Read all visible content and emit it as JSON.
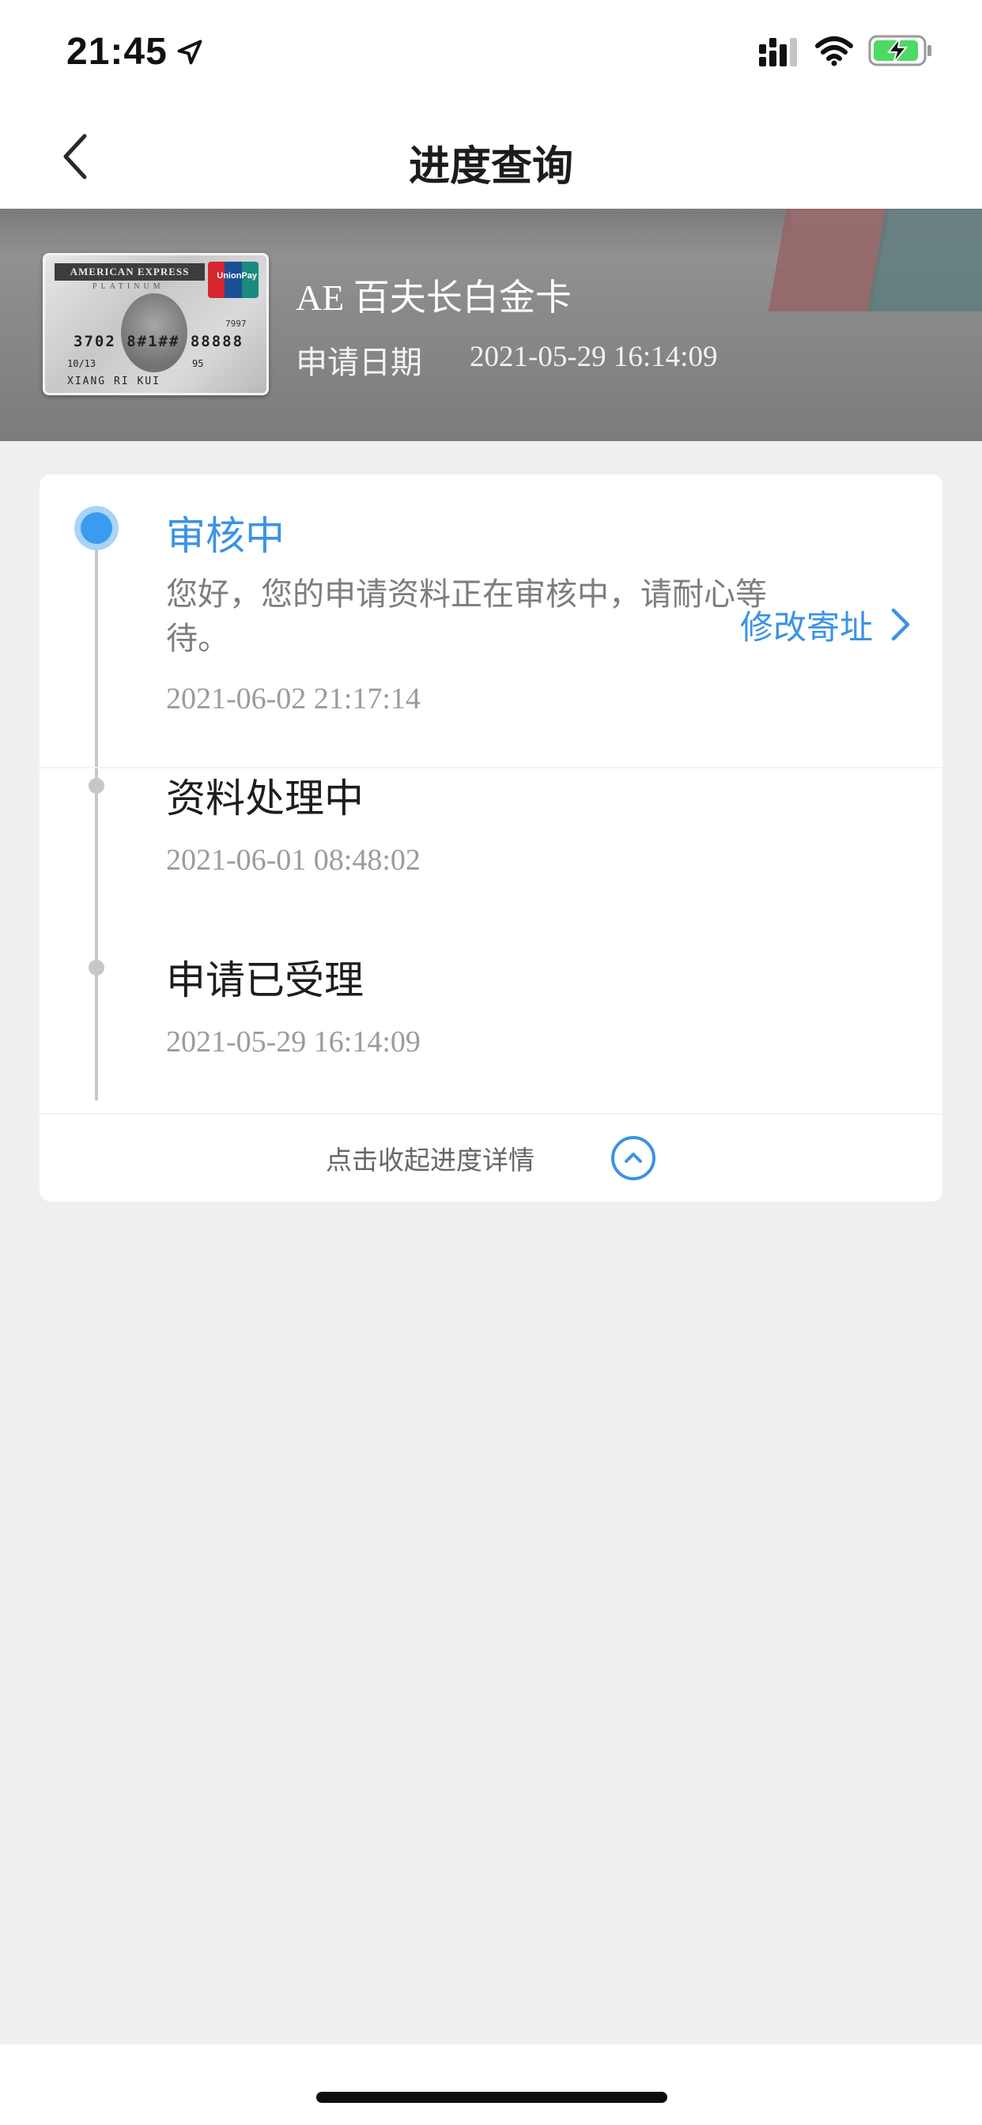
{
  "status_bar": {
    "time": "21:45"
  },
  "nav": {
    "title": "进度查询"
  },
  "card": {
    "brand": "AMERICAN EXPRESS",
    "tier": "PLATINUM",
    "union_pay": "UnionPay",
    "number": "3702 8#1## 88888",
    "code": "7997",
    "expiry": "10/13",
    "cvv": "95",
    "holder": "XIANG RI KUI",
    "name_prefix": "AE ",
    "name": "百夫长白金卡",
    "apply_date_label": "申请日期",
    "apply_date": "2021-05-29 16:14:09"
  },
  "progress": {
    "steps": [
      {
        "title": "审核中",
        "description": "您好，您的申请资料正在审核中，请耐心等待。",
        "time": "2021-06-02 21:17:14",
        "current": true
      },
      {
        "title": "资料处理中",
        "time": "2021-06-01 08:48:02",
        "current": false
      },
      {
        "title": "申请已受理",
        "time": "2021-05-29 16:14:09",
        "current": false
      }
    ],
    "modify_address": "修改寄址",
    "collapse": "点击收起进度详情"
  },
  "colors": {
    "accent": "#3b93e4",
    "background": "#efefef",
    "timeline": "#c7c7c7"
  }
}
